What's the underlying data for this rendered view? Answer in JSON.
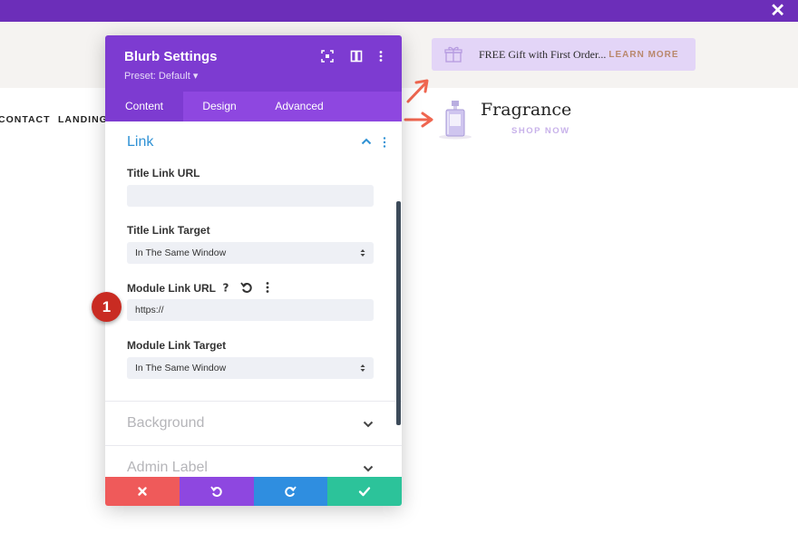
{
  "topbar": {
    "close_icon": "close-icon"
  },
  "site": {
    "banner": {
      "text": "FREE Gift with First Order...",
      "link": "LEARN MORE",
      "icon": "gift-icon"
    },
    "nav": [
      "CONTACT",
      "LANDING"
    ],
    "blurb": {
      "title": "Fragrance",
      "link": "SHOP NOW",
      "image": "perfume-bottle"
    }
  },
  "modal": {
    "title": "Blurb Settings",
    "preset": "Preset: Default ▾",
    "header_icons": [
      "expand-icon",
      "split-view-icon",
      "more-options-icon"
    ],
    "tabs": [
      {
        "label": "Content",
        "active": true
      },
      {
        "label": "Design",
        "active": false
      },
      {
        "label": "Advanced",
        "active": false
      }
    ],
    "section": {
      "title": "Link",
      "fields": {
        "title_link_url": {
          "label": "Title Link URL",
          "value": ""
        },
        "title_link_target": {
          "label": "Title Link Target",
          "value": "In The Same Window"
        },
        "module_link_url": {
          "label": "Module Link URL",
          "value": "https://"
        },
        "module_link_target": {
          "label": "Module Link Target",
          "value": "In The Same Window"
        }
      }
    },
    "collapsed_sections": [
      "Background",
      "Admin Label"
    ],
    "footer": [
      "cancel-icon",
      "undo-icon",
      "redo-icon",
      "save-check-icon"
    ]
  },
  "annotation": {
    "badge": "1"
  },
  "colors": {
    "purple_dark": "#7d3bd1",
    "purple_tab": "#8e47e0",
    "link_blue": "#2e91d4",
    "cancel": "#ef5a5a",
    "undo": "#8e47e0",
    "redo": "#2f8ee0",
    "save": "#2cc39a",
    "badge": "#c92b22"
  }
}
